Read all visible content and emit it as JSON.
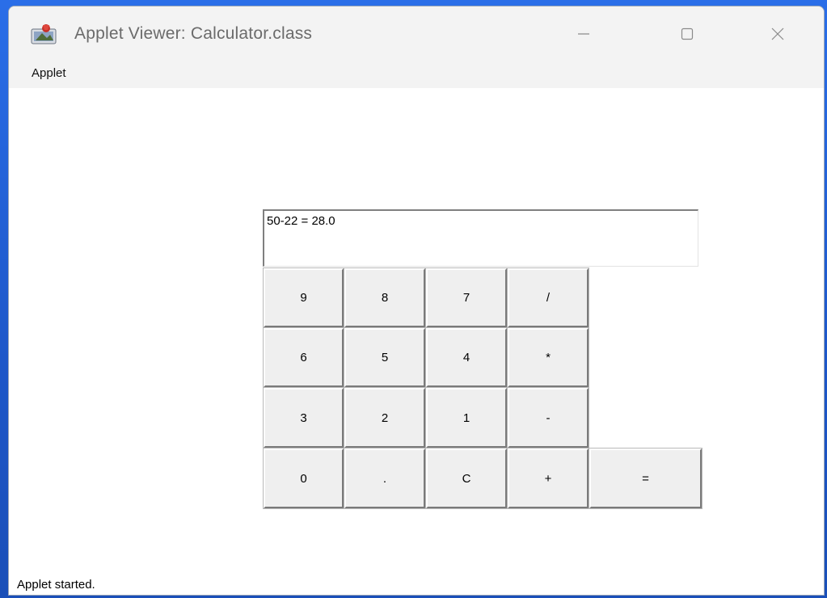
{
  "window": {
    "title": "Applet Viewer: Calculator.class",
    "app_icon": "java-applet-icon",
    "controls": {
      "minimize_icon": "minimize-icon",
      "maximize_icon": "maximize-icon",
      "close_icon": "close-icon"
    }
  },
  "menubar": {
    "items": [
      {
        "label": "Applet"
      }
    ]
  },
  "calculator": {
    "display_value": "50-22 = 28.0",
    "keys": [
      {
        "label": "9"
      },
      {
        "label": "8"
      },
      {
        "label": "7"
      },
      {
        "label": "/"
      },
      {
        "label": "6"
      },
      {
        "label": "5"
      },
      {
        "label": "4"
      },
      {
        "label": "*"
      },
      {
        "label": "3"
      },
      {
        "label": "2"
      },
      {
        "label": "1"
      },
      {
        "label": "-"
      },
      {
        "label": "0"
      },
      {
        "label": "."
      },
      {
        "label": "C"
      },
      {
        "label": "+"
      },
      {
        "label": "="
      }
    ]
  },
  "status": {
    "text": "Applet started."
  }
}
